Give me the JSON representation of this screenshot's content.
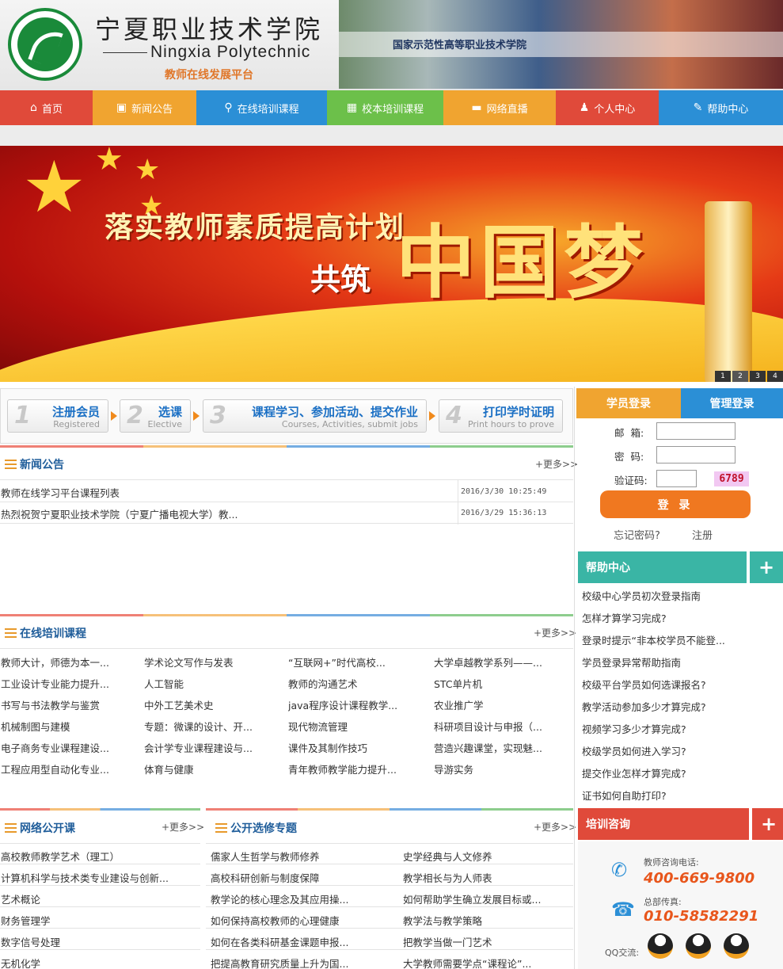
{
  "header": {
    "school_cn": "宁夏职业技术学院",
    "school_en": "Ningxia Polytechnic",
    "platform": "教师在线发展平台",
    "photo_caption": "国家示范性高等职业技术学院"
  },
  "nav": [
    {
      "label": "首页",
      "icon": "home-icon",
      "color": "#e04a3a",
      "glyph": "⌂"
    },
    {
      "label": "新闻公告",
      "icon": "news-icon",
      "color": "#f0a430",
      "glyph": "▣"
    },
    {
      "label": "在线培训课程",
      "icon": "link-icon",
      "color": "#2b8fd6",
      "glyph": "⚲"
    },
    {
      "label": "校本培训课程",
      "icon": "puzzle-icon",
      "color": "#6cc04a",
      "glyph": "▦"
    },
    {
      "label": "网络直播",
      "icon": "broadcast-icon",
      "color": "#f0a430",
      "glyph": "▬"
    },
    {
      "label": "个人中心",
      "icon": "user-icon",
      "color": "#e04a3a",
      "glyph": "♟"
    },
    {
      "label": "帮助中心",
      "icon": "tools-icon",
      "color": "#2b8fd6",
      "glyph": "✎"
    }
  ],
  "banner": {
    "line1": "落实教师素质提高计划",
    "line2": "共筑",
    "line3": "中国梦",
    "pages": [
      "1",
      "2",
      "3",
      "4"
    ]
  },
  "steps": [
    {
      "num": "1",
      "title": "注册会员",
      "sub": "Registered"
    },
    {
      "num": "2",
      "title": "选课",
      "sub": "Elective"
    },
    {
      "num": "3",
      "title": "课程学习、参加活动、提交作业",
      "sub": "Courses, Activities, submit jobs"
    },
    {
      "num": "4",
      "title": "打印学时证明",
      "sub": "Print hours to prove"
    }
  ],
  "news": {
    "title": "新闻公告",
    "more": "+更多>>",
    "items": [
      {
        "text": "教师在线学习平台课程列表",
        "date": "2016/3/30 10:25:49"
      },
      {
        "text": "热烈祝贺宁夏职业技术学院（宁夏广播电视大学）教...",
        "date": "2016/3/29 15:36:13"
      }
    ]
  },
  "courses": {
    "title": "在线培训课程",
    "more": "+更多>>",
    "rows": [
      [
        "教师大计，师德为本一...",
        "学术论文写作与发表",
        "“互联网+”时代高校...",
        "大学卓越教学系列——..."
      ],
      [
        "工业设计专业能力提升...",
        "人工智能",
        "教师的沟通艺术",
        "STC单片机"
      ],
      [
        "书写与书法教学与鉴赏",
        "中外工艺美术史",
        "java程序设计课程教学...",
        "农业推广学"
      ],
      [
        "机械制图与建模",
        "专题：微课的设计、开...",
        "现代物流管理",
        "科研项目设计与申报（..."
      ],
      [
        "电子商务专业课程建设...",
        "会计学专业课程建设与...",
        "课件及其制作技巧",
        "营造兴趣课堂，实现魅..."
      ],
      [
        "工程应用型自动化专业...",
        "体育与健康",
        "青年教师教学能力提升...",
        "导游实务"
      ]
    ]
  },
  "open_courses": {
    "title": "网络公开课",
    "more": "+更多>>",
    "items": [
      "高校教师教学艺术（理工）",
      "计算机科学与技术类专业建设与创新...",
      "艺术概论",
      "财务管理学",
      "数字信号处理",
      "无机化学"
    ]
  },
  "electives": {
    "title": "公开选修专题",
    "more": "+更多>>",
    "rows": [
      [
        "儒家人生哲学与教师修养",
        "史学经典与人文修养"
      ],
      [
        "高校科研创新与制度保障",
        "教学相长与为人师表"
      ],
      [
        "教学论的核心理念及其应用操...",
        "如何帮助学生确立发展目标或..."
      ],
      [
        "如何保持高校教师的心理健康",
        "教学法与教学策略"
      ],
      [
        "如何在各类科研基金课题申报...",
        "把教学当做一门艺术"
      ],
      [
        "把提高教育研究质量上升为国...",
        "大学教师需要学点“课程论”..."
      ]
    ]
  },
  "login": {
    "tab_student": "学员登录",
    "tab_admin": "管理登录",
    "email_label": "邮  箱:",
    "password_label": "密  码:",
    "captcha_label": "验证码:",
    "captcha": "6789",
    "button": "登 录",
    "forgot": "忘记密码?",
    "register": "注册"
  },
  "help": {
    "title": "帮助中心",
    "plus": "+",
    "items": [
      "校级中心学员初次登录指南",
      "怎样才算学习完成?",
      "登录时提示“非本校学员不能登...",
      "学员登录异常帮助指南",
      "校级平台学员如何选课报名?",
      "教学活动参加多少才算完成?",
      "视频学习多少才算完成?",
      "校级学员如何进入学习?",
      "提交作业怎样才算完成?",
      "证书如何自助打印?"
    ]
  },
  "consult": {
    "title": "培训咨询",
    "plus": "+",
    "phone_label": "教师咨询电话:",
    "phone": "400-669-9800",
    "fax_label": "总部传真:",
    "fax": "010-58582291",
    "qq_label": "QQ交流:"
  },
  "colors": {
    "accent_red": "#e04a3a",
    "accent_orange": "#f0a430",
    "accent_blue": "#2b8fd6",
    "teal": "#3ab5a5",
    "login_orange": "#f07820"
  }
}
